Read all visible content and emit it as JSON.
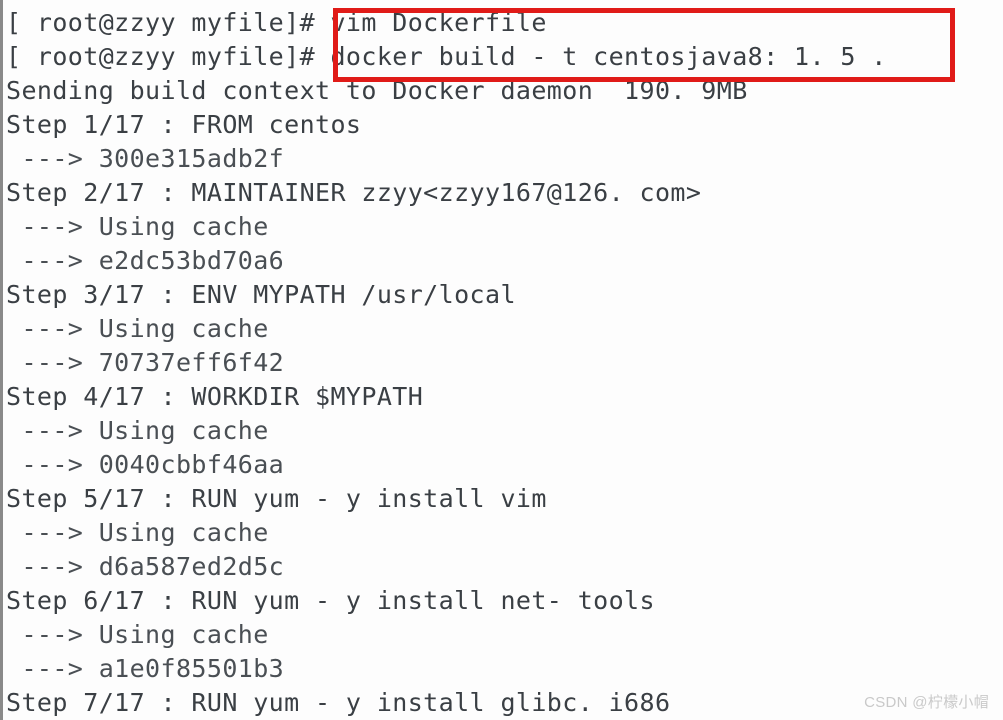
{
  "terminal": {
    "prompt": "[root@zzyy myfile]#",
    "highlighted_commands": [
      "vim Dockerfile",
      "docker build -t centosjava8:1.5 ."
    ],
    "image_tag": "centosjava8:1.5",
    "build_context_size": "190.9MB",
    "total_steps": 17,
    "lines": [
      {
        "id": "line-1",
        "text": "[ root@zzyy myfile]# vim Dockerfile",
        "kind": "command"
      },
      {
        "id": "line-2",
        "text": "[ root@zzyy myfile]# docker build - t centosjava8: 1. 5 .",
        "kind": "command"
      },
      {
        "id": "line-3",
        "text": "Sending build context to Docker daemon  190. 9MB",
        "kind": "output"
      },
      {
        "id": "line-4",
        "text": "Step 1/17 : FROM centos",
        "kind": "step"
      },
      {
        "id": "line-5",
        "text": " ---> 300e315adb2f",
        "kind": "layer"
      },
      {
        "id": "line-6",
        "text": "Step 2/17 : MAINTAINER zzyy<zzyy167@126. com>",
        "kind": "step"
      },
      {
        "id": "line-7",
        "text": " ---> Using cache",
        "kind": "layer"
      },
      {
        "id": "line-8",
        "text": " ---> e2dc53bd70a6",
        "kind": "layer"
      },
      {
        "id": "line-9",
        "text": "Step 3/17 : ENV MYPATH /usr/local",
        "kind": "step"
      },
      {
        "id": "line-10",
        "text": " ---> Using cache",
        "kind": "layer"
      },
      {
        "id": "line-11",
        "text": " ---> 70737eff6f42",
        "kind": "layer"
      },
      {
        "id": "line-12",
        "text": "Step 4/17 : WORKDIR $MYPATH",
        "kind": "step"
      },
      {
        "id": "line-13",
        "text": " ---> Using cache",
        "kind": "layer"
      },
      {
        "id": "line-14",
        "text": " ---> 0040cbbf46aa",
        "kind": "layer"
      },
      {
        "id": "line-15",
        "text": "Step 5/17 : RUN yum - y install vim",
        "kind": "step"
      },
      {
        "id": "line-16",
        "text": " ---> Using cache",
        "kind": "layer"
      },
      {
        "id": "line-17",
        "text": " ---> d6a587ed2d5c",
        "kind": "layer"
      },
      {
        "id": "line-18",
        "text": "Step 6/17 : RUN yum - y install net- tools",
        "kind": "step"
      },
      {
        "id": "line-19",
        "text": " ---> Using cache",
        "kind": "layer"
      },
      {
        "id": "line-20",
        "text": " ---> a1e0f85501b3",
        "kind": "layer"
      },
      {
        "id": "line-21",
        "text": "Step 7/17 : RUN yum - y install glibc. i686",
        "kind": "step"
      }
    ]
  },
  "watermark": {
    "text": "CSDN @柠檬小帽"
  },
  "colors": {
    "background": "#fdfdfd",
    "text": "#3a3f44",
    "annotation_red": "#e01b18",
    "gutter_gray": "#8a8a8a",
    "watermark_gray": "#c9c9c9"
  }
}
